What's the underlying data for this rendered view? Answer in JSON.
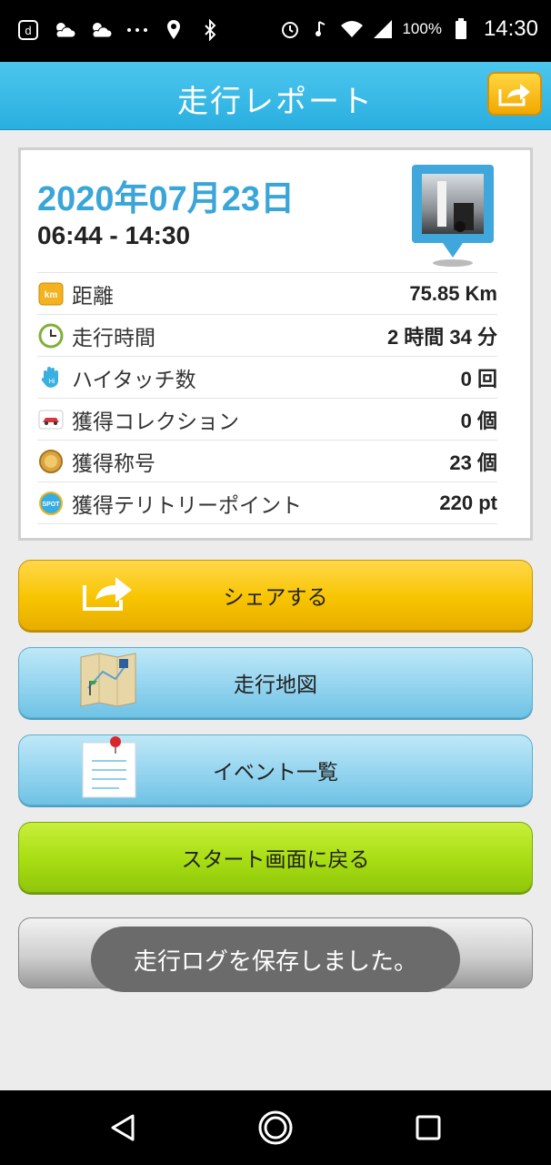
{
  "status_bar": {
    "battery_pct": "100%",
    "time": "14:30",
    "icons": [
      "docomo-icon",
      "cloud-sun-icon",
      "cloud-sun-icon",
      "more-icon",
      "location-icon",
      "bluetooth-icon",
      "alarm-icon",
      "music-icon",
      "wifi-icon",
      "signal-icon",
      "battery-icon"
    ]
  },
  "header": {
    "title": "走行レポート",
    "share_icon": "share-icon"
  },
  "report": {
    "date": "2020年07月23日",
    "time_range": "06:44 - 14:30",
    "stats": [
      {
        "icon": "km-icon",
        "label": "距離",
        "value": "75.85 Km"
      },
      {
        "icon": "clock-icon",
        "label": "走行時間",
        "value": "2 時間 34 分"
      },
      {
        "icon": "high-five-icon",
        "label": "ハイタッチ数",
        "value": "0 回"
      },
      {
        "icon": "car-icon",
        "label": "獲得コレクション",
        "value": "0 個"
      },
      {
        "icon": "medal-icon",
        "label": "獲得称号",
        "value": "23 個"
      },
      {
        "icon": "spot-icon",
        "label": "獲得テリトリーポイント",
        "value": "220 pt"
      }
    ]
  },
  "buttons": {
    "share": "シェアする",
    "map": "走行地図",
    "events": "イベント一覧",
    "back_start": "スタート画面に戻る"
  },
  "toast": "走行ログを保存しました。",
  "colors": {
    "header": "#2aafe0",
    "date": "#3aa6d8",
    "share_button": "#f8c400",
    "map_button": "#93d4ef",
    "start_button": "#a7dd12"
  }
}
